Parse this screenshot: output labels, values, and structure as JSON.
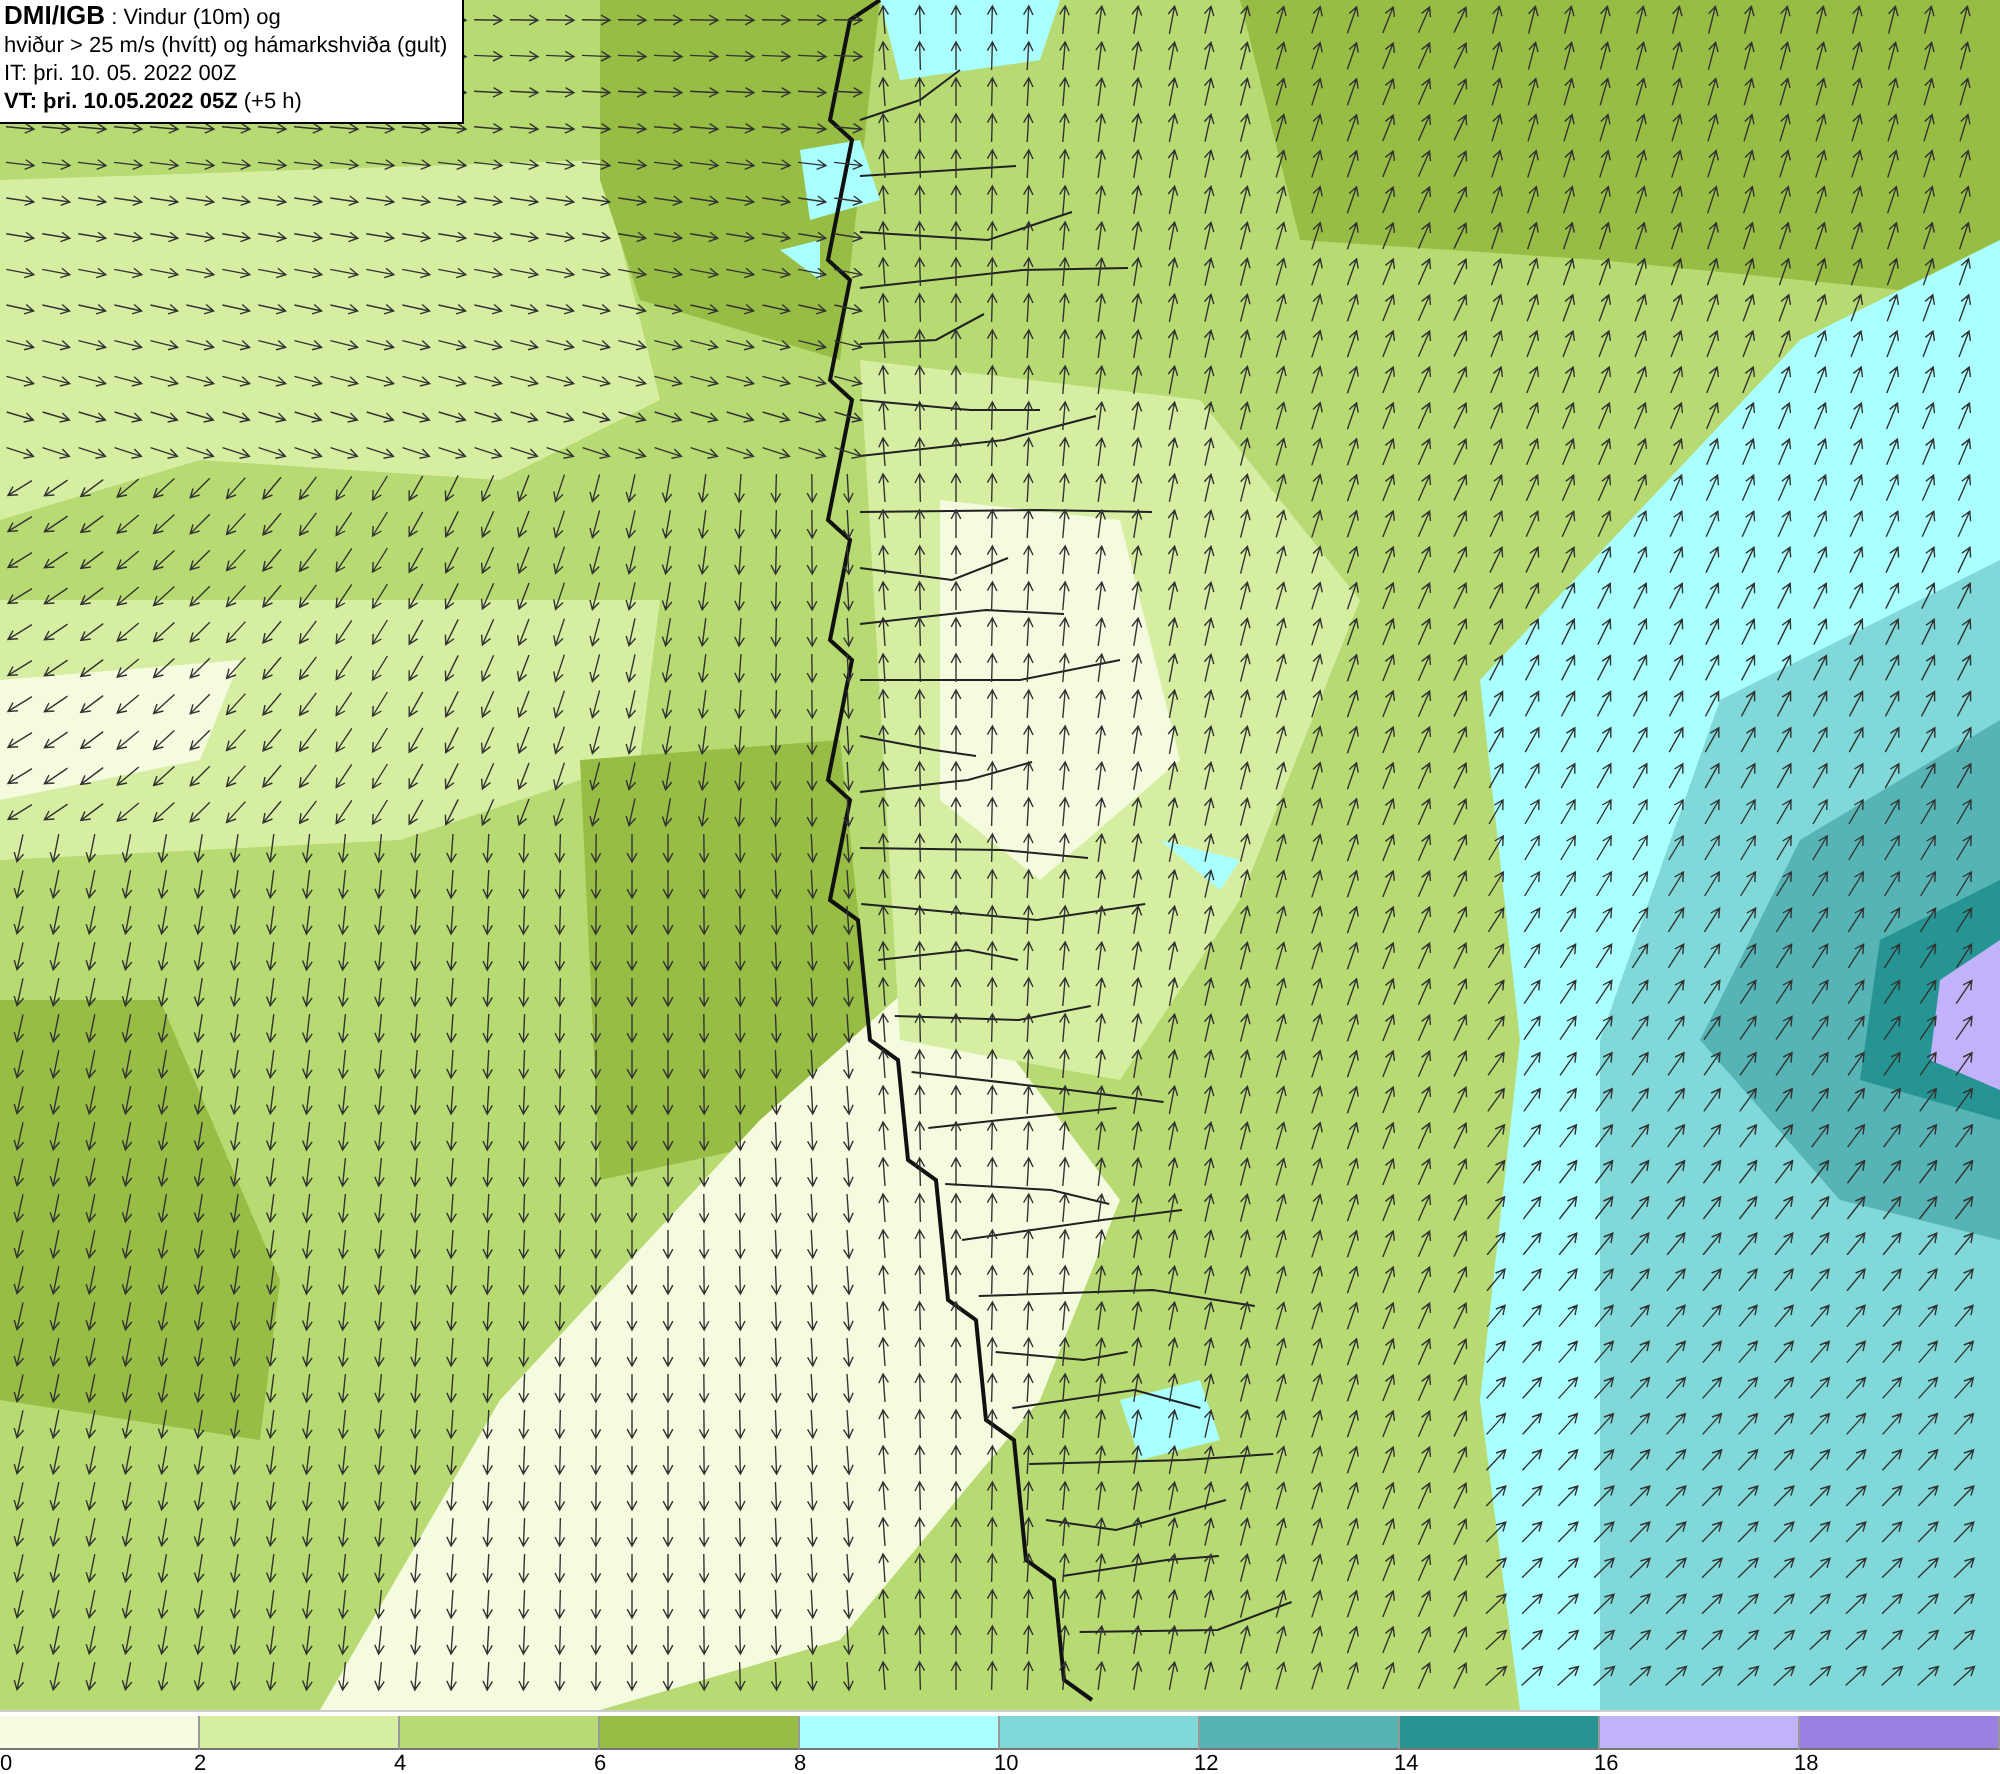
{
  "info_box": {
    "lines": [
      "**DMI/IGB** : Vindur (10m) og",
      "hviður > 25 m/s (hvítt) og hámarkshviða (gult)",
      "IT: þri. 10. 05. 2022 00Z",
      "**VT: þri. 10.05.2022 05Z** (+5 h)"
    ]
  },
  "legend": {
    "bins": [
      {
        "label": "0",
        "color": "#f4fbdf"
      },
      {
        "label": "2",
        "color": "#d6eea2"
      },
      {
        "label": "4",
        "color": "#b7da72"
      },
      {
        "label": "6",
        "color": "#97bd45"
      },
      {
        "label": "8",
        "color": "#aaffff"
      },
      {
        "label": "10",
        "color": "#80d8d8"
      },
      {
        "label": "12",
        "color": "#56b4b4"
      },
      {
        "label": "14",
        "color": "#279494"
      },
      {
        "label": "16",
        "color": "#c2b2fa"
      },
      {
        "label": "18",
        "color": "#9a80e0"
      }
    ]
  }
}
